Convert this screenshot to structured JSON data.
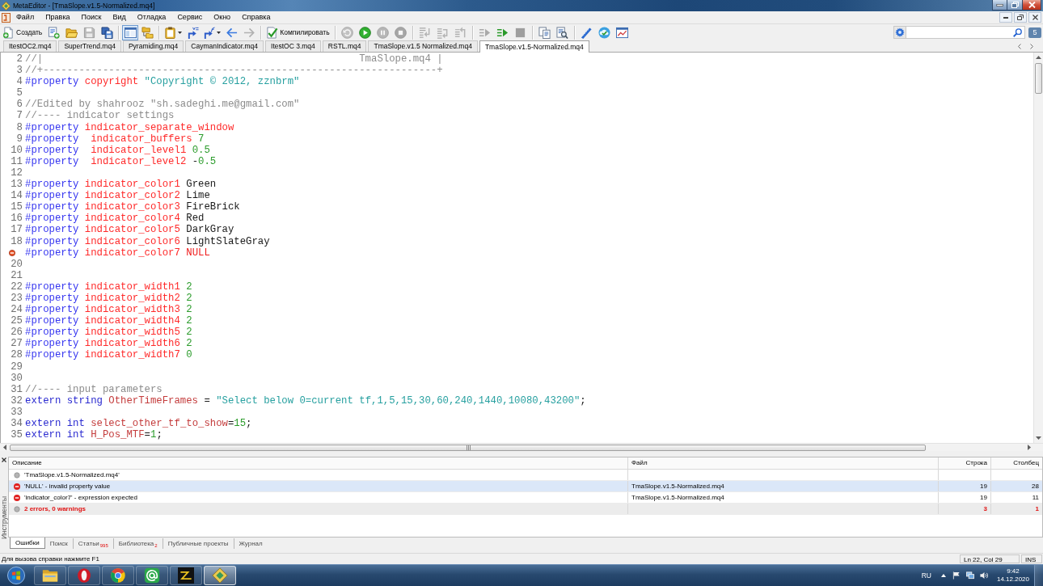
{
  "window": {
    "title": "MetaEditor - [TmaSlope.v1.5-Normalized.mq4]"
  },
  "menu": [
    "Файл",
    "Правка",
    "Поиск",
    "Вид",
    "Отладка",
    "Сервис",
    "Окно",
    "Справка"
  ],
  "toolbar": {
    "groups": [
      [
        {
          "kind": "create",
          "label": "Создать",
          "on": false,
          "disabled": false
        },
        {
          "kind": "template",
          "on": false,
          "disabled": false
        },
        {
          "kind": "open",
          "on": false,
          "disabled": false
        },
        {
          "kind": "save",
          "on": false,
          "disabled": true
        },
        {
          "kind": "saveall",
          "on": false,
          "disabled": false
        }
      ],
      [
        {
          "kind": "navigator",
          "on": true,
          "disabled": false
        },
        {
          "kind": "toolbox",
          "on": false,
          "disabled": false
        }
      ],
      [
        {
          "kind": "clipboard",
          "on": false,
          "disabled": false
        },
        {
          "kind": "variable",
          "on": false,
          "disabled": false
        },
        {
          "kind": "function",
          "on": false,
          "disabled": false
        },
        {
          "kind": "back",
          "on": false,
          "disabled": false
        },
        {
          "kind": "forward",
          "on": false,
          "disabled": true
        }
      ],
      [
        {
          "kind": "compile",
          "label": "Компилировать",
          "on": false,
          "disabled": false
        }
      ],
      [
        {
          "kind": "history",
          "on": false,
          "disabled": true
        },
        {
          "kind": "start",
          "on": false,
          "disabled": false
        },
        {
          "kind": "pause",
          "on": false,
          "disabled": true
        },
        {
          "kind": "stop",
          "on": false,
          "disabled": true
        }
      ],
      [
        {
          "kind": "stepin",
          "on": false,
          "disabled": true
        },
        {
          "kind": "stepover",
          "on": false,
          "disabled": true
        },
        {
          "kind": "stepout",
          "on": false,
          "disabled": true
        }
      ],
      [
        {
          "kind": "next",
          "on": false,
          "disabled": true
        },
        {
          "kind": "run",
          "on": false,
          "disabled": false
        },
        {
          "kind": "halt",
          "on": false,
          "disabled": true
        }
      ],
      [
        {
          "kind": "copy",
          "on": false,
          "disabled": false
        },
        {
          "kind": "preview",
          "on": false,
          "disabled": false
        }
      ],
      [
        {
          "kind": "style",
          "on": false,
          "disabled": false
        },
        {
          "kind": "cloud",
          "on": false,
          "disabled": false
        },
        {
          "kind": "chart",
          "on": false,
          "disabled": false
        }
      ]
    ],
    "notification_count": "5"
  },
  "tabs": [
    {
      "label": "ItestOC2.mq4",
      "selected": false
    },
    {
      "label": "SuperTrend.mq4",
      "selected": false
    },
    {
      "label": "Pyramiding.mq4",
      "selected": false
    },
    {
      "label": "CaymanIndicator.mq4",
      "selected": false
    },
    {
      "label": "ItestOC 3.mq4",
      "selected": false
    },
    {
      "label": "RSTL.mq4",
      "selected": false
    },
    {
      "label": "TmaSlope.v1.5 Normalized.mq4",
      "selected": false
    },
    {
      "label": "TmaSlope.v1.5-Normalized.mq4",
      "selected": true
    }
  ],
  "editor": {
    "lines": [
      {
        "number": "2",
        "error": false,
        "tokens": [
          {
            "kind": "comment",
            "text": "//|                                                     TmaSlope.mq4 |"
          }
        ]
      },
      {
        "number": "3",
        "error": false,
        "tokens": [
          {
            "kind": "comment",
            "text": "//+------------------------------------------------------------------+"
          }
        ]
      },
      {
        "number": "4",
        "error": false,
        "tokens": [
          {
            "kind": "directive",
            "text": "#property "
          },
          {
            "kind": "name",
            "text": "copyright "
          },
          {
            "kind": "string",
            "text": "\"Copyright © 2012, zznbrm\""
          }
        ]
      },
      {
        "number": "5",
        "error": false
      },
      {
        "number": "6",
        "error": false,
        "tokens": [
          {
            "kind": "comment",
            "text": "//Edited by shahrooz \"sh.sadeghi.me@gmail.com\""
          }
        ]
      },
      {
        "number": "7",
        "error": false,
        "tokens": [
          {
            "kind": "comment",
            "text": "//---- indicator settings"
          }
        ]
      },
      {
        "number": "8",
        "error": false,
        "tokens": [
          {
            "kind": "directive",
            "text": "#property "
          },
          {
            "kind": "name",
            "text": "indicator_separate_window"
          }
        ]
      },
      {
        "number": "9",
        "error": false,
        "tokens": [
          {
            "kind": "directive",
            "text": "#property  "
          },
          {
            "kind": "name",
            "text": "indicator_buffers "
          },
          {
            "kind": "number",
            "text": "7"
          }
        ]
      },
      {
        "number": "10",
        "error": false,
        "tokens": [
          {
            "kind": "directive",
            "text": "#property  "
          },
          {
            "kind": "name",
            "text": "indicator_level1 "
          },
          {
            "kind": "number",
            "text": "0.5"
          }
        ]
      },
      {
        "number": "11",
        "error": false,
        "tokens": [
          {
            "kind": "directive",
            "text": "#property  "
          },
          {
            "kind": "name",
            "text": "indicator_level2 "
          },
          {
            "kind": "plain",
            "text": "-"
          },
          {
            "kind": "number",
            "text": "0.5"
          }
        ]
      },
      {
        "number": "12",
        "error": false
      },
      {
        "number": "13",
        "error": false,
        "tokens": [
          {
            "kind": "directive",
            "text": "#property "
          },
          {
            "kind": "name",
            "text": "indicator_color1 "
          },
          {
            "kind": "plain",
            "text": "Green"
          }
        ]
      },
      {
        "number": "14",
        "error": false,
        "tokens": [
          {
            "kind": "directive",
            "text": "#property "
          },
          {
            "kind": "name",
            "text": "indicator_color2 "
          },
          {
            "kind": "plain",
            "text": "Lime"
          }
        ]
      },
      {
        "number": "15",
        "error": false,
        "tokens": [
          {
            "kind": "directive",
            "text": "#property "
          },
          {
            "kind": "name",
            "text": "indicator_color3 "
          },
          {
            "kind": "plain",
            "text": "FireBrick"
          }
        ]
      },
      {
        "number": "16",
        "error": false,
        "tokens": [
          {
            "kind": "directive",
            "text": "#property "
          },
          {
            "kind": "name",
            "text": "indicator_color4 "
          },
          {
            "kind": "plain",
            "text": "Red"
          }
        ]
      },
      {
        "number": "17",
        "error": false,
        "tokens": [
          {
            "kind": "directive",
            "text": "#property "
          },
          {
            "kind": "name",
            "text": "indicator_color5 "
          },
          {
            "kind": "plain",
            "text": "DarkGray"
          }
        ]
      },
      {
        "number": "18",
        "error": false,
        "tokens": [
          {
            "kind": "directive",
            "text": "#property "
          },
          {
            "kind": "name",
            "text": "indicator_color6 "
          },
          {
            "kind": "plain",
            "text": "LightSlateGray"
          }
        ]
      },
      {
        "error": true,
        "tokens": [
          {
            "kind": "directive",
            "text": "#property "
          },
          {
            "kind": "name",
            "text": "indicator_color7 "
          },
          {
            "kind": "constant",
            "text": "NULL"
          }
        ]
      },
      {
        "number": "20",
        "error": false
      },
      {
        "number": "21",
        "error": false
      },
      {
        "number": "22",
        "error": false,
        "tokens": [
          {
            "kind": "directive",
            "text": "#property "
          },
          {
            "kind": "name",
            "text": "indicator_width1 "
          },
          {
            "kind": "number",
            "text": "2"
          }
        ]
      },
      {
        "number": "23",
        "error": false,
        "tokens": [
          {
            "kind": "directive",
            "text": "#property "
          },
          {
            "kind": "name",
            "text": "indicator_width2 "
          },
          {
            "kind": "number",
            "text": "2"
          }
        ]
      },
      {
        "number": "24",
        "error": false,
        "tokens": [
          {
            "kind": "directive",
            "text": "#property "
          },
          {
            "kind": "name",
            "text": "indicator_width3 "
          },
          {
            "kind": "number",
            "text": "2"
          }
        ]
      },
      {
        "number": "25",
        "error": false,
        "tokens": [
          {
            "kind": "directive",
            "text": "#property "
          },
          {
            "kind": "name",
            "text": "indicator_width4 "
          },
          {
            "kind": "number",
            "text": "2"
          }
        ]
      },
      {
        "number": "26",
        "error": false,
        "tokens": [
          {
            "kind": "directive",
            "text": "#property "
          },
          {
            "kind": "name",
            "text": "indicator_width5 "
          },
          {
            "kind": "number",
            "text": "2"
          }
        ]
      },
      {
        "number": "27",
        "error": false,
        "tokens": [
          {
            "kind": "directive",
            "text": "#property "
          },
          {
            "kind": "name",
            "text": "indicator_width6 "
          },
          {
            "kind": "number",
            "text": "2"
          }
        ]
      },
      {
        "number": "28",
        "error": false,
        "tokens": [
          {
            "kind": "directive",
            "text": "#property "
          },
          {
            "kind": "name",
            "text": "indicator_width7 "
          },
          {
            "kind": "number",
            "text": "0"
          }
        ]
      },
      {
        "number": "29",
        "error": false
      },
      {
        "number": "30",
        "error": false
      },
      {
        "number": "31",
        "error": false,
        "tokens": [
          {
            "kind": "comment",
            "text": "//---- input parameters"
          }
        ]
      },
      {
        "number": "32",
        "error": false,
        "tokens": [
          {
            "kind": "keyword",
            "text": "extern string "
          },
          {
            "kind": "identifier",
            "text": "OtherTimeFrames"
          },
          {
            "kind": "plain",
            "text": " = "
          },
          {
            "kind": "string",
            "text": "\"Select below 0=current tf,1,5,15,30,60,240,1440,10080,43200\""
          },
          {
            "kind": "plain",
            "text": ";"
          }
        ]
      },
      {
        "number": "33",
        "error": false
      },
      {
        "number": "34",
        "error": false,
        "tokens": [
          {
            "kind": "keyword",
            "text": "extern int "
          },
          {
            "kind": "identifier",
            "text": "select_other_tf_to_show"
          },
          {
            "kind": "plain",
            "text": "="
          },
          {
            "kind": "number",
            "text": "15"
          },
          {
            "kind": "plain",
            "text": ";"
          }
        ]
      },
      {
        "number": "35",
        "error": false,
        "tokens": [
          {
            "kind": "keyword",
            "text": "extern int "
          },
          {
            "kind": "identifier",
            "text": "H_Pos_MTF"
          },
          {
            "kind": "plain",
            "text": "="
          },
          {
            "kind": "number",
            "text": "1"
          },
          {
            "kind": "plain",
            "text": ";"
          }
        ]
      }
    ]
  },
  "panel": {
    "title": "Инструменты",
    "columns": [
      "Описание",
      "Файл",
      "Строка",
      "Столбец"
    ],
    "rows": [
      {
        "kind": "info",
        "selected": false,
        "description": "'TmaSlope.v1.5-Normalized.mq4'"
      },
      {
        "kind": "error",
        "selected": true,
        "description": "'NULL' - invalid property value",
        "file": "TmaSlope.v1.5-Normalized.mq4",
        "line": "19",
        "column": "28"
      },
      {
        "kind": "error",
        "selected": false,
        "description": "'indicator_color7' - expression expected",
        "file": "TmaSlope.v1.5-Normalized.mq4",
        "line": "19",
        "column": "11"
      },
      {
        "kind": "summary",
        "selected": false,
        "description": "2 errors, 0 warnings",
        "line": "3",
        "column": "1"
      }
    ],
    "tabs": [
      {
        "label": "Ошибки",
        "selected": true
      },
      {
        "label": "Поиск",
        "selected": false
      },
      {
        "label": "Статьи",
        "count": "995",
        "selected": false
      },
      {
        "label": "Библиотека",
        "count": "2",
        "selected": false
      },
      {
        "label": "Публичные проекты",
        "selected": false
      },
      {
        "label": "Журнал",
        "selected": false
      }
    ]
  },
  "status_bar": {
    "hint": "Для вызова справки нажмите F1",
    "position": "Ln 22, Col 29",
    "mode": "INS"
  },
  "taskbar": {
    "apps": [
      {
        "kind": "explorer",
        "active": false
      },
      {
        "kind": "opera",
        "active": false
      },
      {
        "kind": "chrome",
        "active": false
      },
      {
        "kind": "mail",
        "active": false
      },
      {
        "kind": "zx",
        "active": false
      },
      {
        "kind": "metaeditor",
        "active": true
      }
    ],
    "language": "RU",
    "time": "9:42",
    "date": "14.12.2020"
  }
}
